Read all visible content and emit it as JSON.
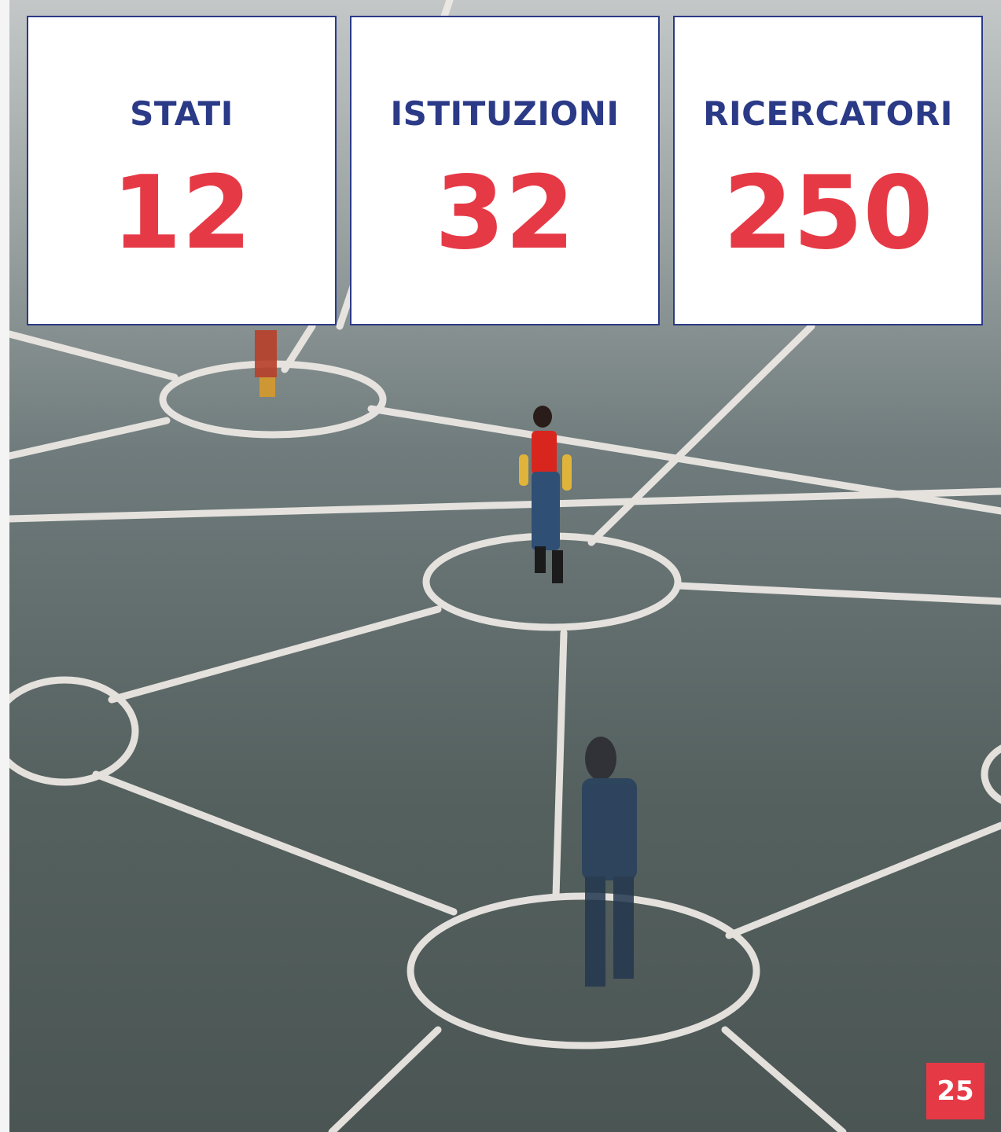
{
  "stats": [
    {
      "label": "STATI",
      "value": "12"
    },
    {
      "label": "ISTITUZIONI",
      "value": "32"
    },
    {
      "label": "RICERCATORI",
      "value": "250"
    }
  ],
  "page_number": "25",
  "colors": {
    "label": "#2b3a87",
    "value": "#e63946",
    "badge": "#e63946",
    "card_border": "#2b3a87"
  },
  "background_image": "network-figurines-photo"
}
